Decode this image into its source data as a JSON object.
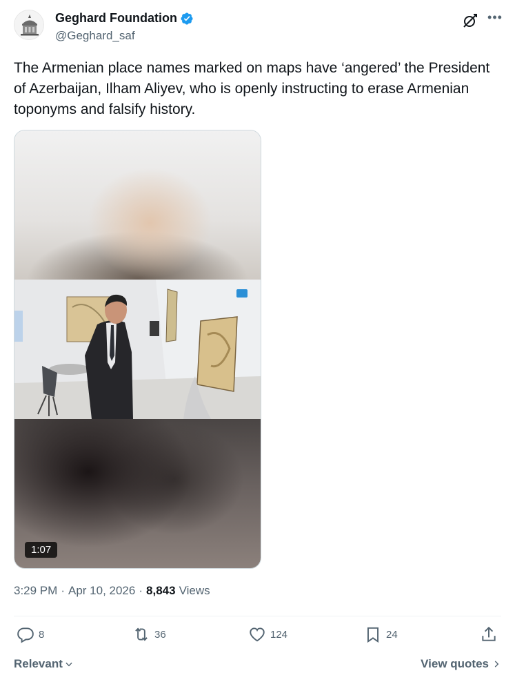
{
  "author": {
    "display_name": "Geghard Foundation",
    "handle": "@Geghard_saf",
    "verified": true
  },
  "tweet": {
    "text": "The Armenian place names marked on maps have ‘angered’ the President of Azerbaijan, Ilham Aliyev, who is openly instructing to erase Armenian toponyms and falsify history."
  },
  "media": {
    "type": "video",
    "duration": "1:07"
  },
  "meta": {
    "time": "3:29 PM",
    "separator": "·",
    "date": "Apr 10, 2026",
    "views_count": "8,843",
    "views_label": "Views"
  },
  "actions": {
    "replies": "8",
    "reposts": "36",
    "likes": "124",
    "bookmarks": "24"
  },
  "footer": {
    "sort_label": "Relevant",
    "view_quotes_label": "View quotes"
  },
  "colors": {
    "text_primary": "#0f1419",
    "text_secondary": "#536471",
    "verified_blue": "#1d9bf0",
    "border": "#cfd9de"
  }
}
